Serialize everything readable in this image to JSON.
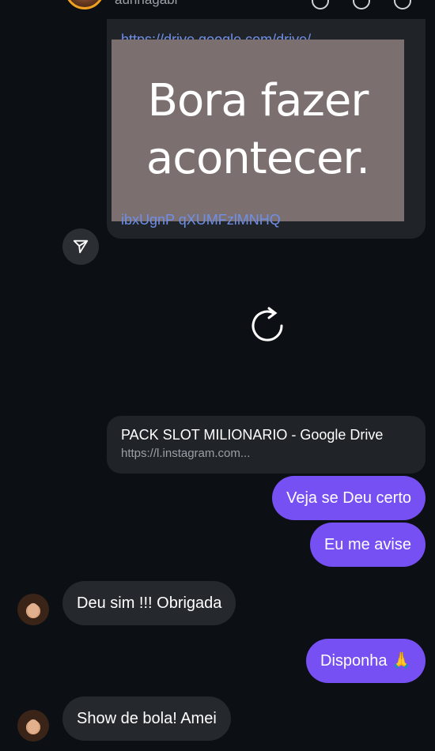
{
  "header": {
    "username": "aunhagabi",
    "icons": [
      "phone-icon",
      "video-icon",
      "flag-icon"
    ]
  },
  "shared_post": {
    "link_top": "https://drive.google.com/drive/",
    "link_bottom": "ibxUgnP qXUMFzlMNHQ",
    "overlay_text": "Bora fazer acontecer.",
    "share_icon": "send-icon"
  },
  "loading_icon": "refresh-icon",
  "link_preview": {
    "title": "PACK SLOT MILIONARIO - Google Drive",
    "url": "https://l.instagram.com..."
  },
  "messages": [
    {
      "type": "sent",
      "text": "Veja se Deu certo"
    },
    {
      "type": "sent",
      "text": "Eu me avise"
    },
    {
      "type": "received",
      "text": "Deu sim !!! Obrigada"
    },
    {
      "type": "sent",
      "text": "Disponha 🙏"
    },
    {
      "type": "received",
      "text": "Show de bola! Amei"
    }
  ],
  "colors": {
    "background": "#0c0f14",
    "sent_bubble": "#7650f3",
    "received_bubble": "#25282c",
    "link": "#6f8fe8"
  }
}
